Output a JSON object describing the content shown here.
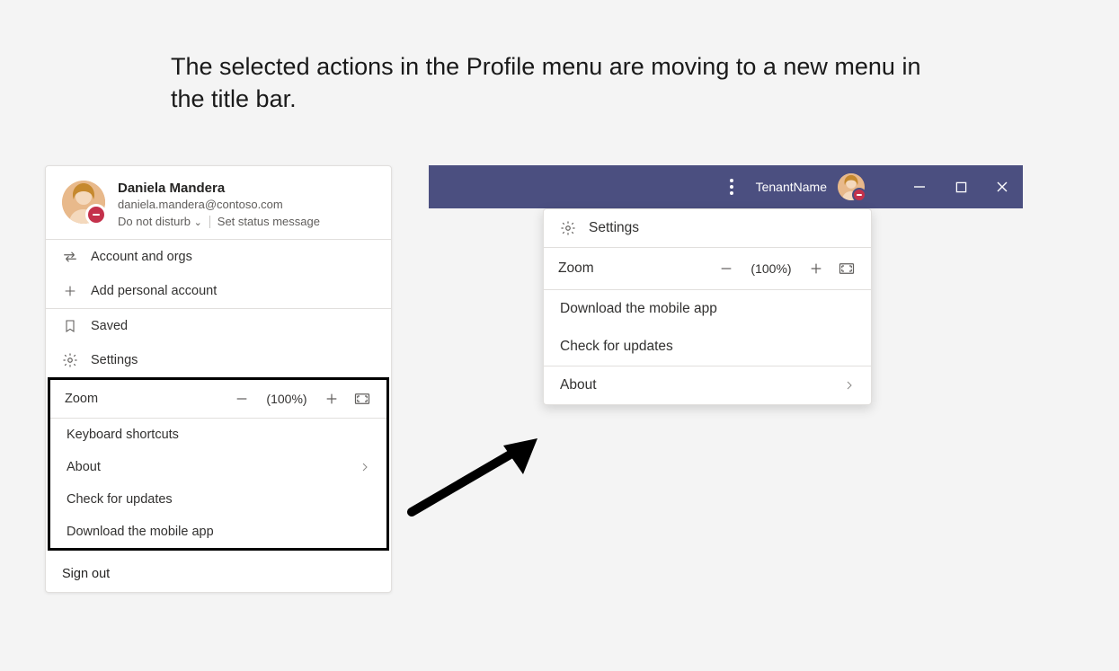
{
  "caption": "The selected actions in the Profile menu are moving to a new menu in the title bar.",
  "profile": {
    "name": "Daniela Mandera",
    "email": "daniela.mandera@contoso.com",
    "presence": "Do not disturb",
    "set_status_label": "Set status message"
  },
  "left_menu": {
    "account_orgs": "Account and orgs",
    "add_personal": "Add personal account",
    "saved": "Saved",
    "settings": "Settings",
    "zoom_label": "Zoom",
    "zoom_value": "(100%)",
    "keyboard_shortcuts": "Keyboard shortcuts",
    "about": "About",
    "check_updates": "Check for updates",
    "download_mobile": "Download the mobile app",
    "sign_out": "Sign out"
  },
  "titlebar": {
    "tenant": "TenantName"
  },
  "right_menu": {
    "settings": "Settings",
    "zoom_label": "Zoom",
    "zoom_value": "(100%)",
    "download_mobile": "Download the mobile app",
    "check_updates": "Check for updates",
    "about": "About"
  }
}
